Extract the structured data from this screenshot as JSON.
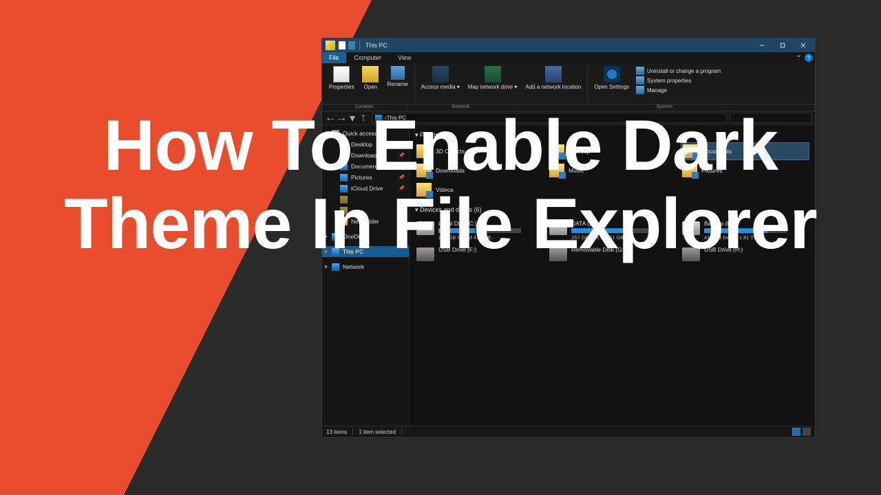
{
  "headline": "How To Enable Dark Theme In File Explorer",
  "window": {
    "title": "This PC",
    "menu": {
      "file": "File",
      "computer": "Computer",
      "view": "View"
    },
    "ribbon": {
      "properties": "Properties",
      "open": "Open",
      "rename": "Rename",
      "access_media": "Access media ▾",
      "map_drive": "Map network drive ▾",
      "add_location": "Add a network location",
      "open_settings": "Open Settings",
      "uninstall": "Uninstall or change a program",
      "sys_props": "System properties",
      "manage": "Manage",
      "group_location": "Location",
      "group_network": "Network",
      "group_system": "System"
    },
    "address": "This PC",
    "nav": {
      "quick": "Quick access",
      "desktop": "Desktop",
      "downloads": "Downloads",
      "documents": "Documents",
      "pictures": "Pictures",
      "icloud": "iCloud Drive",
      "newfolder": "New folder",
      "onedrive": "OneDrive",
      "thispc": "This PC",
      "network": "Network"
    },
    "sections": {
      "folders": "Folders (7)",
      "drives": "Devices and drives (6)"
    },
    "folders": {
      "f0": "3D Objects",
      "f1": "Desktop",
      "f2": "Documents",
      "f3": "Downloads",
      "f4": "Music",
      "f5": "Pictures",
      "f6": "Videos"
    },
    "drives": [
      {
        "name": "Local Disk (C:)",
        "free": "232 GB free of 418 GB",
        "pct": 44
      },
      {
        "name": "DATA (D:)",
        "free": "257 GB free of 931 GB",
        "pct": 72
      },
      {
        "name": "Backup (E:)",
        "free": "412 GB free of 1.81 TB",
        "pct": 77
      },
      {
        "name": "USB Drive (F:)",
        "free": "",
        "pct": null
      },
      {
        "name": "Removable Disk (G:)",
        "free": "",
        "pct": null
      },
      {
        "name": "USB Drive (H:)",
        "free": "",
        "pct": null
      }
    ],
    "status": {
      "items": "13 items",
      "selected": "1 item selected"
    }
  }
}
